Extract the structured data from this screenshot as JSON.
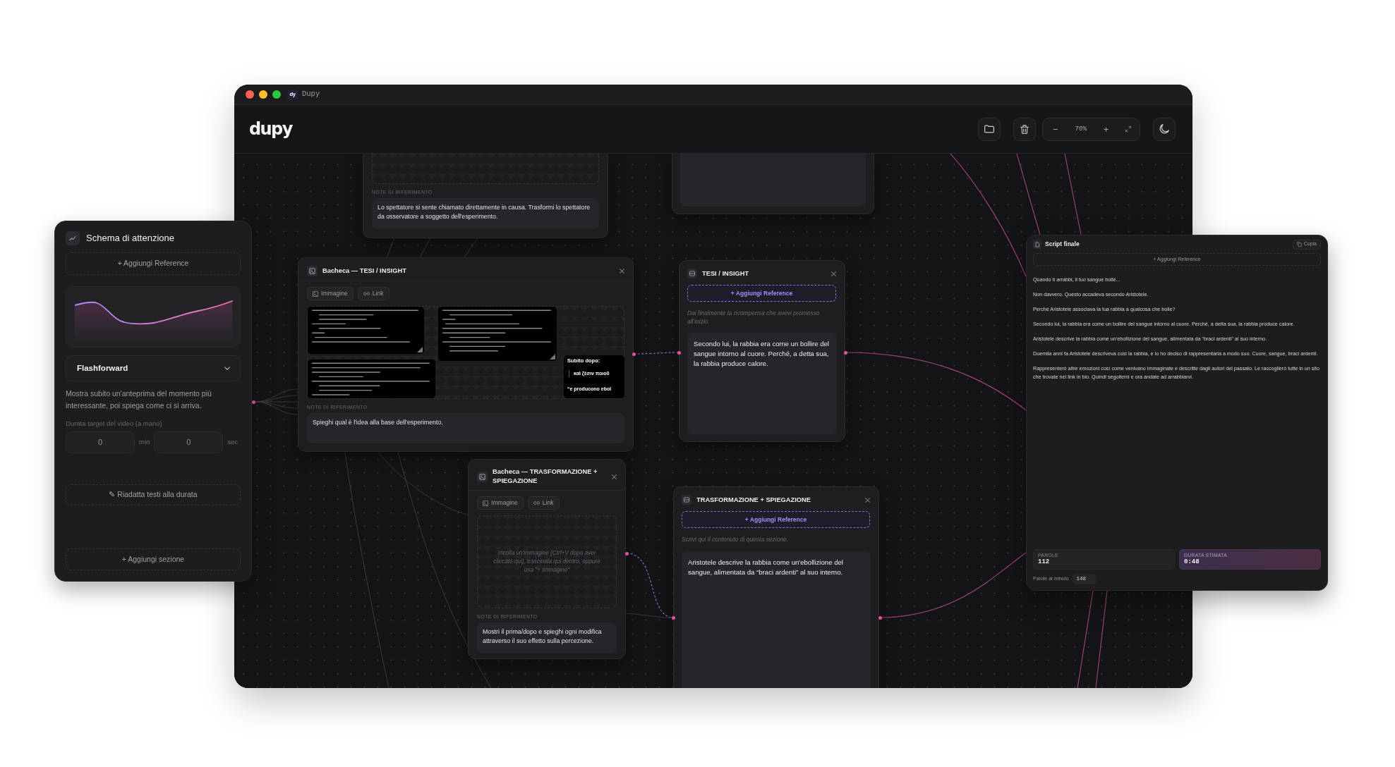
{
  "window": {
    "title": "Dupy",
    "badge": "dy"
  },
  "header": {
    "logo": "dupy",
    "zoom": {
      "out": "−",
      "level": "70%",
      "in": "+"
    }
  },
  "canvas": {
    "nodes": [
      {
        "kind": "board",
        "note_label": "NOTE DI RIFERIMENTO",
        "note": "Lo spettatore si sente chiamato direttamente in causa. Trasformi lo spettatore da osservatore a soggetto dell'esperimento."
      },
      {
        "kind": "section"
      },
      {
        "kind": "board",
        "title": "Bacheca — TESI / INSIGHT",
        "buttons": [
          {
            "kind": "image",
            "label": "Immagine"
          },
          {
            "kind": "link",
            "label": "Link"
          }
        ],
        "images": [
          {
            "kind": "document"
          },
          {
            "kind": "document"
          },
          {
            "kind": "document"
          },
          {
            "kind": "quote",
            "lines": [
              "Subito dopo:",
              "καὶ ζέσιν ποιοῦ",
              "“e producono ebol"
            ]
          }
        ],
        "note_label": "NOTE DI RIFERIMENTO",
        "note": "Spieghi qual è l'idea alla base dell'esperimento."
      },
      {
        "kind": "section",
        "title": "TESI / INSIGHT",
        "reference_button": "+ Aggiungi Reference",
        "hint": "Dai finalmente la ricompensa che avevi promesso all'inizio.",
        "text": "Secondo lui, la rabbia era come un bollire del sangue intorno al cuore. Perché, a detta sua, la rabbia produce calore."
      },
      {
        "kind": "board",
        "title": "Bacheca — TRASFORMAZIONE + SPIEGAZIONE",
        "buttons": [
          {
            "kind": "image",
            "label": "Immagine"
          },
          {
            "kind": "link",
            "label": "Link"
          }
        ],
        "drop_placeholder": "Incolla un'immagine (Ctrl+V dopo aver cliccato qui), trascinala qui dentro, oppure usa \"+ Immagine\"",
        "note_label": "NOTE DI RIFERIMENTO",
        "note": "Mostri il prima/dopo e spieghi ogni modifica attraverso il suo effetto sulla percezione."
      },
      {
        "kind": "section",
        "title": "TRASFORMAZIONE + SPIEGAZIONE",
        "reference_button": "+ Aggiungi Reference",
        "hint": "Scrivi qui il contenuto di questa sezione.",
        "text": "Aristotele descrive la rabbia come un'ebollizione del sangue, alimentata da “braci ardenti” al suo interno."
      }
    ]
  },
  "attention_panel": {
    "title": "Schema di attenzione",
    "reference_button": "+ Aggiungi Reference",
    "pattern": "Flashforward",
    "description": "Mostra subito un'anteprima del momento più interessante, poi spiega come ci si arriva.",
    "duration_label": "Durata target del video (a mano)",
    "duration": [
      {
        "value": "0",
        "unit": "min"
      },
      {
        "value": "0",
        "unit": "sec"
      }
    ],
    "fit_button": "✎ Riadatta testi alla durata",
    "add_button": "+ Aggiungi sezione"
  },
  "script_panel": {
    "title": "Script finale",
    "copy_button": "Copia",
    "reference_button": "+ Aggiungi Reference",
    "paragraphs": [
      "Quando ti arrabbi, il tuo sangue bolle...",
      "Non davvero. Questo accadeva secondo Aristotele.",
      "Perché Aristotele associava la tua rabbia a qualcosa che bolle?",
      "Secondo lui, la rabbia era come un bollire del sangue intorno al cuore. Perché, a detta sua, la rabbia produce calore.",
      "Aristotele descrive la rabbia come un'ebollizione del sangue, alimentata da “braci ardenti” al suo interno.",
      "Duemila anni fa Aristotele descriveva così la rabbia, e io ho deciso di rappresentarla a modo suo. Cuore, sangue, braci ardenti.",
      "Rappresenterò altre emozioni così come venivano immaginate e descritte dagli autori del passato. Le raccoglierò tutte in un sito che trovate nel link in bio. Quindi seguitemi e ora andate ad arrabbiarvi."
    ],
    "stats": [
      {
        "label": "PAROLE",
        "value": "112",
        "highlight": false
      },
      {
        "label": "DURATA STIMATA",
        "value": "0:48",
        "highlight": true
      }
    ],
    "wpm_label": "Parole al minuto",
    "wpm": "148"
  }
}
